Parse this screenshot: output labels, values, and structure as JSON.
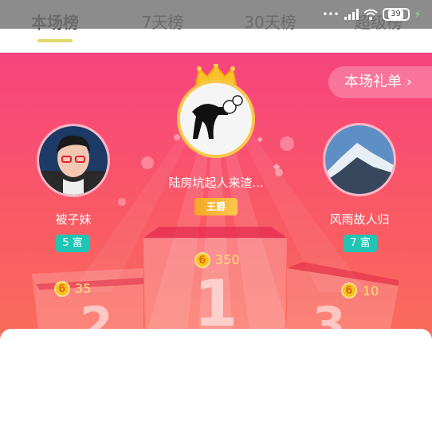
{
  "statusbar": {
    "battery": "39"
  },
  "tabs": [
    {
      "label": "本场榜",
      "active": true
    },
    {
      "label": "7天榜",
      "active": false
    },
    {
      "label": "30天榜",
      "active": false
    },
    {
      "label": "超级榜",
      "active": false
    }
  ],
  "gift_button": {
    "label": "本场礼单 ›"
  },
  "first": {
    "name": "陆房坑起人来渣...",
    "badge": "王爵",
    "score": "350"
  },
  "second": {
    "name": "被子妹",
    "badge": "5 富",
    "score": "35",
    "podium": "2"
  },
  "third": {
    "name": "风雨故人归",
    "badge": "7 富",
    "score": "10",
    "podium": "3"
  },
  "podium_first": "1",
  "icons": [
    "crown-icon",
    "coin-icon",
    "wifi-icon",
    "signal-icon",
    "battery-icon"
  ],
  "colors": {
    "hero_top": "#f7437f",
    "hero_bottom": "#fb7a55",
    "badge": "#20c5b5",
    "score": "#ffe27a"
  }
}
